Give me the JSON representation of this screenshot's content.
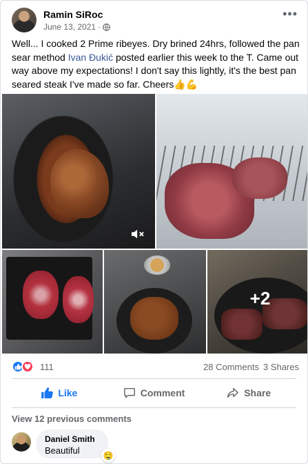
{
  "post": {
    "author": "Ramin SiRoc",
    "date": "June 13, 2021",
    "separator": "·",
    "more_icon": "more-horizontal-icon",
    "text_before": "Well... I cooked 2 Prime ribeyes. Dry brined 24hrs, followed the pan sear method ",
    "mention": "Ivan Đukić",
    "text_after": " posted earlier this week to the T. Came out way above my expectations! I don't say this lightly, it's the best pan seared steak I've made so far. Cheers",
    "emoji": "👍💪"
  },
  "photos": {
    "extra_count": "+2"
  },
  "reactions": {
    "count": "111",
    "comments": "28 Comments",
    "shares": "3 Shares",
    "like_color": "#1877f2",
    "love_color": "#f33e58"
  },
  "actions": {
    "like": "Like",
    "comment": "Comment",
    "share": "Share"
  },
  "comments": {
    "view_previous": "View 12 previous comments",
    "items": [
      {
        "author": "Daniel Smith",
        "text": "Beautiful",
        "reaction": "🤤"
      }
    ]
  }
}
